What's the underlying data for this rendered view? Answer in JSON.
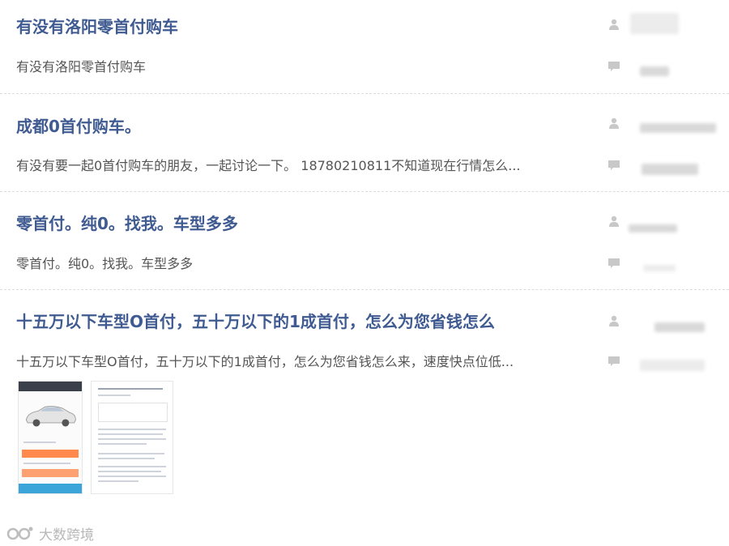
{
  "posts": [
    {
      "title": "有没有洛阳零首付购车",
      "excerpt": "有没有洛阳零首付购车"
    },
    {
      "title": "成都0首付购车。",
      "excerpt": "有没有要一起0首付购车的朋友，一起讨论一下。 18780210811不知道现在行情怎么..."
    },
    {
      "title": "零首付。纯0。找我。车型多多",
      "excerpt": "零首付。纯0。找我。车型多多"
    },
    {
      "title": "十五万以下车型O首付，五十万以下的1成首付，怎么为您省钱怎么",
      "excerpt": "十五万以下车型O首付，五十万以下的1成首付，怎么为您省钱怎么来，速度快点位低..."
    }
  ],
  "icons": {
    "author": "user-icon",
    "reply": "comment-icon"
  },
  "watermark": {
    "text": "大数跨境"
  },
  "colors": {
    "title": "#3f5b91",
    "excerpt": "#555555",
    "icon": "#c8c8c8",
    "divider": "#dcdcdc"
  }
}
